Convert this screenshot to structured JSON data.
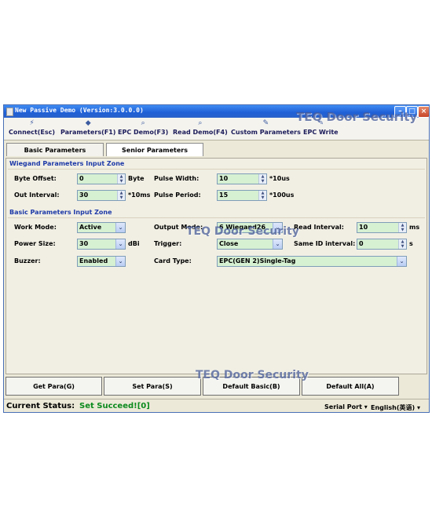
{
  "window": {
    "title": "New Passive Demo (Version:3.0.0.0)"
  },
  "watermark": "TEQ Door Security",
  "toolbar": {
    "items": [
      {
        "label": "Connect(Esc)",
        "icon": "connect-icon"
      },
      {
        "label": "Parameters(F1)",
        "icon": "parameters-icon"
      },
      {
        "label": "EPC Demo(F3)",
        "icon": "epc-demo-icon"
      },
      {
        "label": "Read Demo(F4)",
        "icon": "read-demo-icon"
      },
      {
        "label": "Custom Parameters",
        "icon": "custom-parameters-icon"
      },
      {
        "label": "EPC Write",
        "icon": "epc-write-icon"
      }
    ]
  },
  "tabs": [
    {
      "label": "Basic Parameters",
      "active": true
    },
    {
      "label": "Senior Parameters",
      "active": false
    }
  ],
  "wiegand": {
    "title": "Wiegand Parameters Input Zone",
    "byte_offset": {
      "label": "Byte Offset:",
      "value": "0",
      "unit": "Byte"
    },
    "pulse_width": {
      "label": "Pulse Width:",
      "value": "10",
      "unit": "*10us"
    },
    "out_interval": {
      "label": "Out Interval:",
      "value": "30",
      "unit": "*10ms"
    },
    "pulse_period": {
      "label": "Pulse Period:",
      "value": "15",
      "unit": "*100us"
    }
  },
  "basic": {
    "title": "Basic Parameters Input Zone",
    "work_mode": {
      "label": "Work Mode:",
      "value": "Active"
    },
    "output_mode": {
      "label": "Output Mode:",
      "value": "6 Wiegand26"
    },
    "read_interval": {
      "label": "Read Interval:",
      "value": "10",
      "unit": "ms"
    },
    "power_size": {
      "label": "Power Size:",
      "value": "30",
      "unit": "dBi"
    },
    "trigger": {
      "label": "Trigger:",
      "value": "Close"
    },
    "same_id_interval": {
      "label": "Same ID interval:",
      "value": "0",
      "unit": "s"
    },
    "buzzer": {
      "label": "Buzzer:",
      "value": "Enabled"
    },
    "card_type": {
      "label": "Card Type:",
      "value": "EPC(GEN 2)Single-Tag"
    }
  },
  "buttons": {
    "get_para": "Get Para(G)",
    "set_para": "Set Para(S)",
    "default_basic": "Default Basic(B)",
    "default_all": "Default All(A)"
  },
  "status": {
    "label": "Current Status:",
    "value": "Set Succeed![0]",
    "serial_port": "Serial Port",
    "language": "English(英语)"
  },
  "colors": {
    "field_bg": "#d6f0d2",
    "status_ok": "#0b8a1d",
    "section_title": "#1e3aa8",
    "titlebar": "#1f5fd6"
  }
}
